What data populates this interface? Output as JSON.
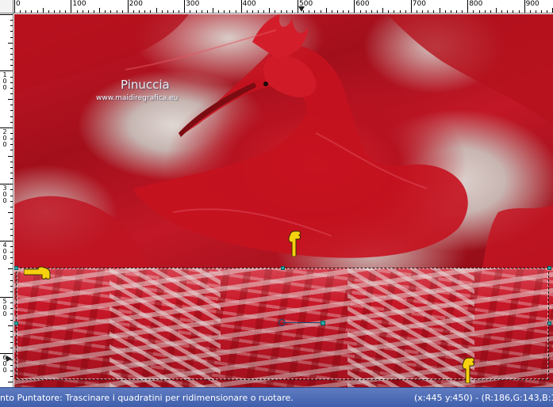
{
  "ruler": {
    "top_labels": [
      "0",
      "100",
      "200",
      "300",
      "400",
      "500",
      "600",
      "700",
      "800",
      "900"
    ],
    "left_labels": [
      "100",
      "200",
      "300",
      "400",
      "500",
      "600"
    ]
  },
  "watermark": {
    "name": "Pinuccia",
    "url": "www.maidiregrafica.eu"
  },
  "statusbar": {
    "tool_text": "nto Puntatore: Trascinare i quadratini per ridimensionare o ruotare.",
    "coords_text": "(x:445 y:450) - (R:186,G:143,B:139"
  },
  "colors": {
    "statusbar": "#4a68b3",
    "selection_handle": "#2aa6a6",
    "pointer_hand": "#f6d10f"
  }
}
